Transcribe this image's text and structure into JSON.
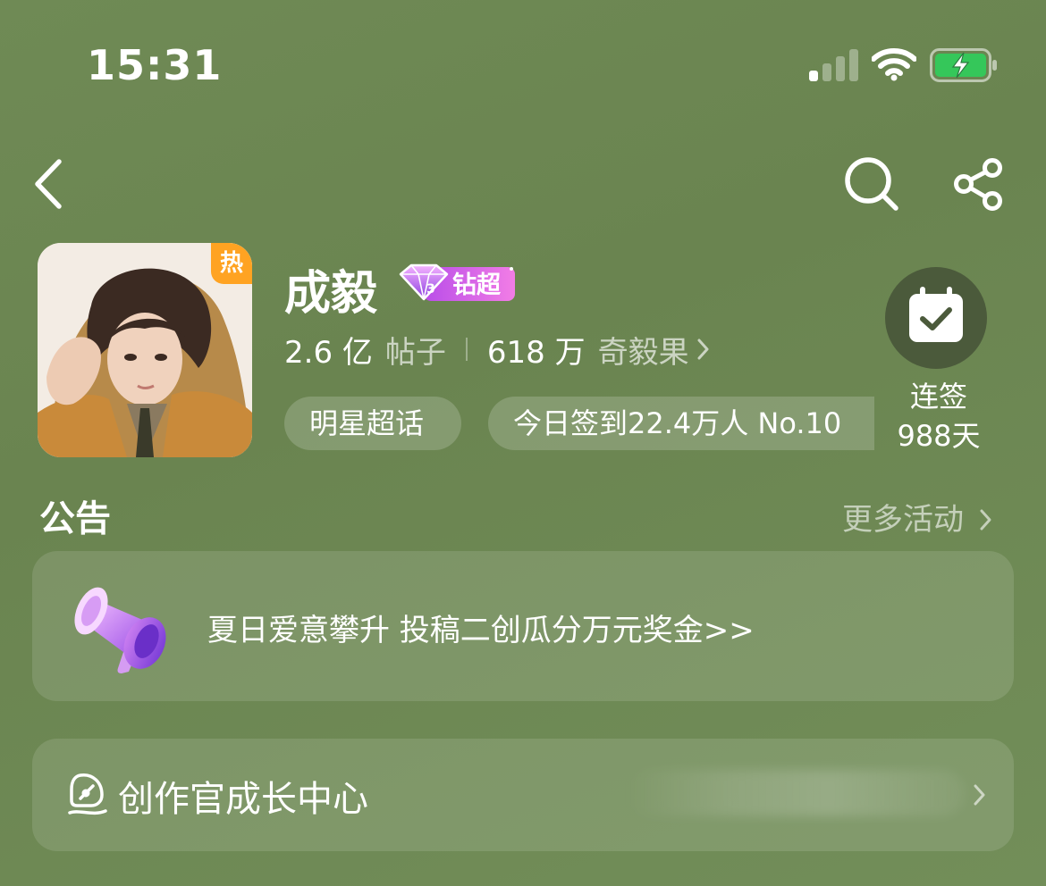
{
  "status_bar": {
    "time": "15:31",
    "icons": [
      "signal-icon",
      "wifi-icon",
      "battery-charging-icon"
    ],
    "battery_color": "#35c75a"
  },
  "nav": {
    "icons": [
      "back-icon",
      "search-icon",
      "share-icon"
    ]
  },
  "topic": {
    "hot_badge": "热",
    "name": "成毅",
    "tier_badge": "钻超",
    "posts_count": "2.6 亿",
    "posts_label": "帖子",
    "fans_count": "618 万",
    "fans_label": "奇毅果",
    "tag": "明星超话",
    "checkin_info": "今日签到22.4万人 No.10",
    "streak_label": "连签",
    "streak_days": "988天"
  },
  "announcement": {
    "title": "公告",
    "more_label": "更多活动",
    "notice_text": "夏日爱意攀升 投稿二创瓜分万元奖金>>"
  },
  "creator": {
    "label": "创作官成长中心"
  },
  "colors": {
    "background": "#6d8752",
    "hot_badge": "#ffa322",
    "tier_badge": "#d85cf0",
    "checkin_circle": "#4b5a3b"
  }
}
